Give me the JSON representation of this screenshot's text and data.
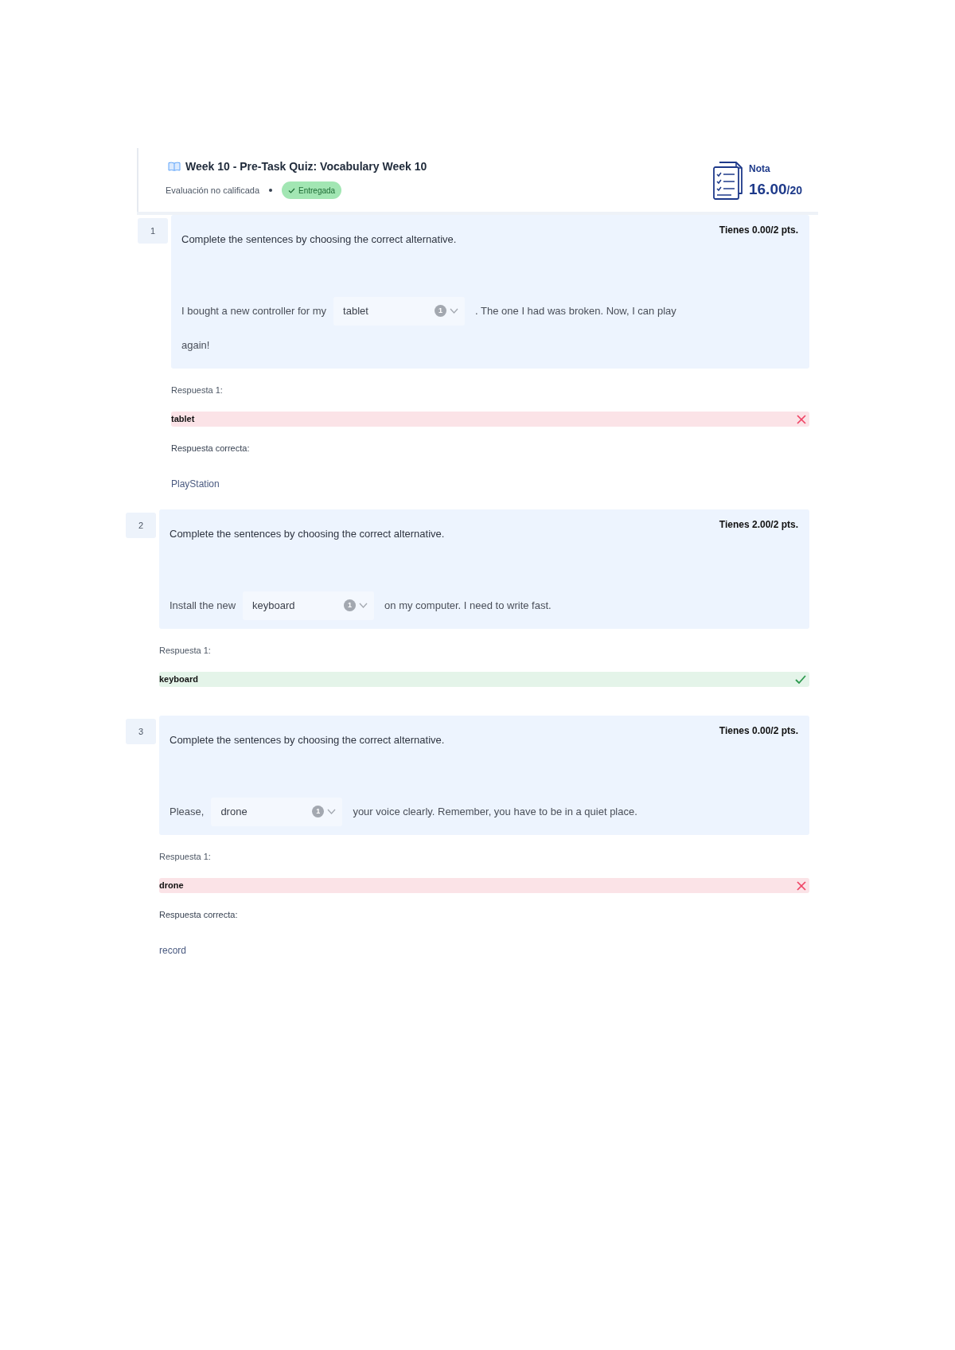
{
  "header": {
    "title": "Week 10 - Pre-Task Quiz: Vocabulary Week 10",
    "grading": "Evaluación no calificada",
    "badge": "Entregada",
    "grade": {
      "label": "Nota",
      "score": "16.00",
      "total": "/20"
    }
  },
  "questions": [
    {
      "number": "1",
      "points": "Tienes 0.00/2 pts.",
      "instruction": "Complete the sentences by choosing the correct alternative.",
      "sentence_lines": [
        [
          {
            "kind": "text",
            "text": "I bought a new controller for my"
          },
          {
            "kind": "dropdown",
            "value": "tablet",
            "badge": "1"
          },
          {
            "kind": "text",
            "text": ". The one I had was broken. Now, I can play"
          }
        ],
        [
          {
            "kind": "text",
            "text": "again!"
          }
        ]
      ],
      "response_label": "Respuesta 1:",
      "response": {
        "value": "tablet",
        "correct": false
      },
      "correct_answer_label": "Respuesta correcta:",
      "correct_answer": "PlayStation"
    },
    {
      "number": "2",
      "points": "Tienes 2.00/2 pts.",
      "instruction": "Complete the sentences by choosing the correct alternative.",
      "sentence_lines": [
        [
          {
            "kind": "text",
            "text": "Install the new"
          },
          {
            "kind": "dropdown",
            "value": "keyboard",
            "badge": "1"
          },
          {
            "kind": "text",
            "text": "on my computer. I need to write fast."
          }
        ]
      ],
      "response_label": "Respuesta 1:",
      "response": {
        "value": "keyboard",
        "correct": true
      }
    },
    {
      "number": "3",
      "points": "Tienes 0.00/2 pts.",
      "instruction": "Complete the sentences by choosing the correct alternative.",
      "sentence_lines": [
        [
          {
            "kind": "text",
            "text": "Please,"
          },
          {
            "kind": "dropdown",
            "value": "drone",
            "badge": "1"
          },
          {
            "kind": "text",
            "text": "your voice clearly. Remember, you have to be in a quiet place."
          }
        ]
      ],
      "response_label": "Respuesta 1:",
      "response": {
        "value": "drone",
        "correct": false
      },
      "correct_answer_label": "Respuesta correcta:",
      "correct_answer": "record"
    }
  ]
}
